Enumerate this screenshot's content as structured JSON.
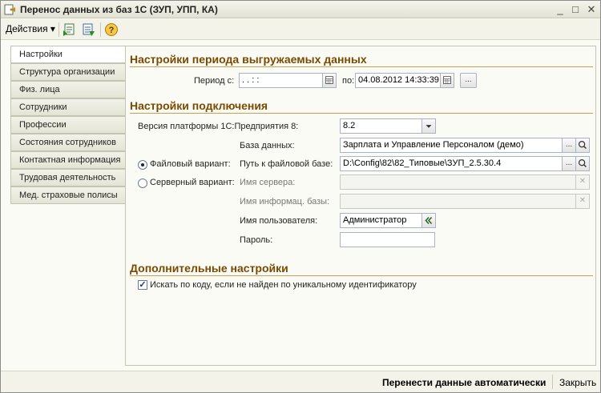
{
  "window": {
    "title": "Перенос данных из баз 1С (ЗУП, УПП, КА)",
    "minimize": "_",
    "maximize": "□",
    "close": "✕"
  },
  "toolbar": {
    "actions_label": "Действия",
    "actions_arrow": "▾",
    "help_glyph": "?"
  },
  "tabs": [
    {
      "label": "Настройки",
      "active": true
    },
    {
      "label": "Структура организации"
    },
    {
      "label": "Физ. лица"
    },
    {
      "label": "Сотрудники"
    },
    {
      "label": "Профессии"
    },
    {
      "label": "Состояния сотрудников"
    },
    {
      "label": "Контактная информация"
    },
    {
      "label": "Трудовая деятельность"
    },
    {
      "label": "Мед. страховые полисы"
    }
  ],
  "period_section": {
    "title": "Настройки периода выгружаемых данных",
    "period_label": "Период с:",
    "from_value": " .  .       :  :  ",
    "to_label": "по:",
    "to_value": "04.08.2012 14:33:39",
    "more_button": "..."
  },
  "connection_section": {
    "title": "Настройки подключения",
    "platform_label": "Версия платформы 1С:Предприятия 8:",
    "platform_value": "8.2",
    "db_label": "База данных:",
    "db_value": "Зарплата и Управление Персоналом (демо)",
    "file_option_label": "Файловый вариант:",
    "file_path_label": "Путь к файловой базе:",
    "file_path_value": "D:\\Config\\82\\82_Типовые\\ЗУП_2.5.30.4",
    "server_option_label": "Серверный вариант:",
    "server_name_label": "Имя сервера:",
    "server_name_value": "",
    "infobase_label": "Имя информац. базы:",
    "infobase_value": "",
    "user_label": "Имя пользователя:",
    "user_value": "Администратор",
    "password_label": "Пароль:",
    "password_value": ""
  },
  "extra_section": {
    "title": "Дополнительные настройки",
    "search_by_code_label": "Искать по коду, если не найден по уникальному идентификатору",
    "search_by_code_checked": true
  },
  "footer": {
    "move_label": "Перенести данные автоматически",
    "close_label": "Закрыть"
  },
  "colors": {
    "section_title": "#7a4a00",
    "section_line": "#c9a050",
    "field_border": "#a9b3c4"
  }
}
